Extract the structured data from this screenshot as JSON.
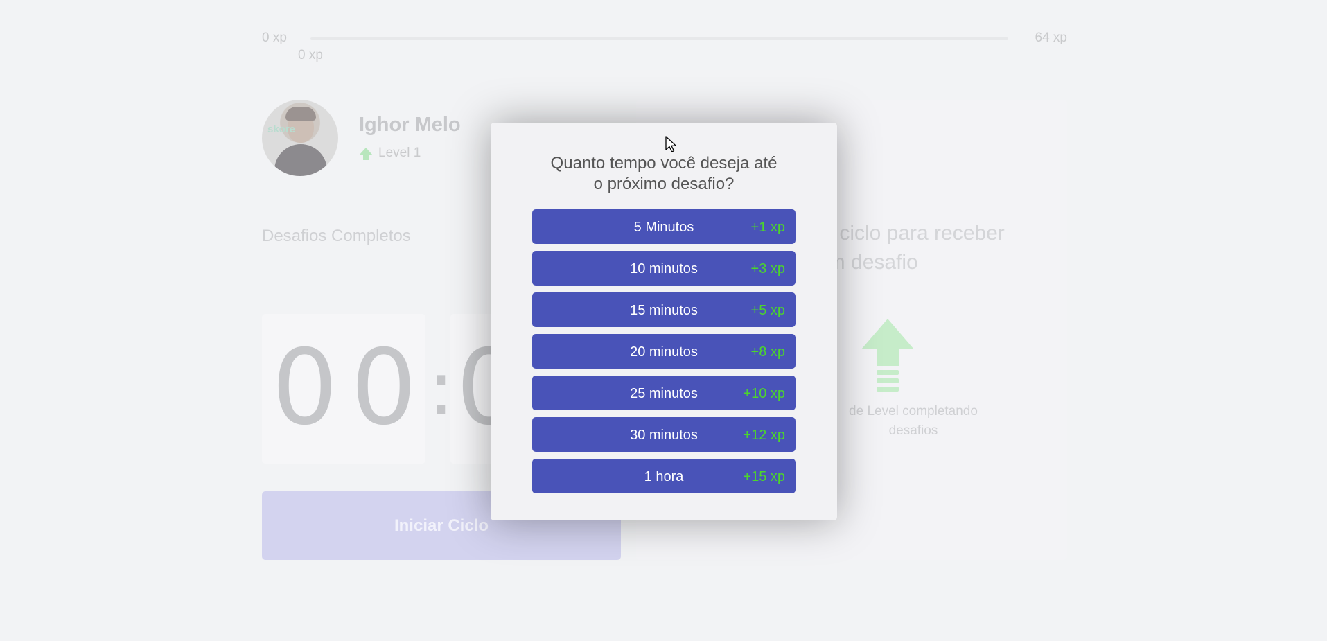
{
  "xp_bar": {
    "min": "0 xp",
    "max": "64 xp",
    "current": "0 xp",
    "progress": 0
  },
  "profile": {
    "avatar_text": "skore",
    "name": "Ighor Melo",
    "level": "Level 1"
  },
  "challenges": {
    "completed_label": "Desafios Completos"
  },
  "timer": {
    "min_tens": "0",
    "min_ones": "0",
    "separator": ":",
    "visible_partial": "0"
  },
  "start_button": {
    "label": "Iniciar Ciclo"
  },
  "challenge_card": {
    "heading_line1": "m ciclo para receber",
    "heading_line2": "um desafio",
    "text_line1": "de Level completando",
    "text_line2": "desafios",
    "icon": "level-up-icon"
  },
  "modal": {
    "title_line1": "Quanto tempo você deseja até",
    "title_line2": "o próximo desafio?",
    "options": [
      {
        "label": "5 Minutos",
        "xp": "+1 xp"
      },
      {
        "label": "10 minutos",
        "xp": "+3 xp"
      },
      {
        "label": "15 minutos",
        "xp": "+5 xp"
      },
      {
        "label": "20 minutos",
        "xp": "+8 xp"
      },
      {
        "label": "25 minutos",
        "xp": "+10 xp"
      },
      {
        "label": "30 minutos",
        "xp": "+12 xp"
      },
      {
        "label": "1 hora",
        "xp": "+15 xp"
      }
    ]
  },
  "colors": {
    "option_bg": "#4953b8",
    "xp_green": "#4cd62b",
    "backdrop": "#f2f3f5"
  }
}
